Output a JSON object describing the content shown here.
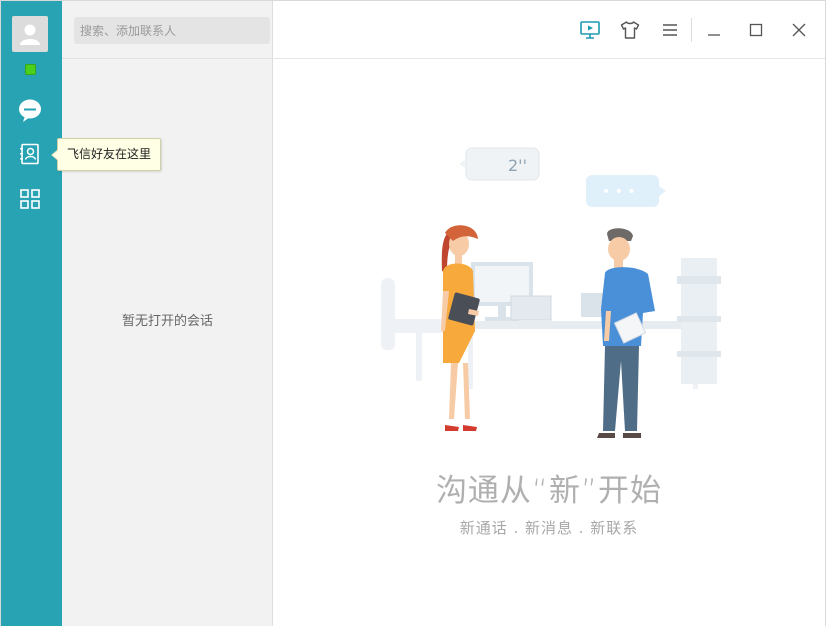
{
  "rail": {
    "status_color": "#49d11d",
    "accent": "#27a3b4",
    "items": [
      {
        "icon": "chat-bubble-icon"
      },
      {
        "icon": "contacts-icon"
      },
      {
        "icon": "apps-grid-icon"
      }
    ]
  },
  "tooltip": {
    "text": "飞信好友在这里"
  },
  "search": {
    "placeholder": "搜索、添加联系人"
  },
  "sessions": {
    "empty_text": "暂无打开的会话"
  },
  "illustration": {
    "bubble_left_text": "2''",
    "bubble_right_text": "• • •"
  },
  "main": {
    "headline": "沟通从“新”开始",
    "subline": "新通话 . 新消息 . 新联系"
  },
  "toolbar": {
    "icons": [
      "video-icon",
      "theme-shirt-icon",
      "menu-icon",
      "minimize-icon",
      "maximize-icon",
      "close-icon"
    ]
  }
}
